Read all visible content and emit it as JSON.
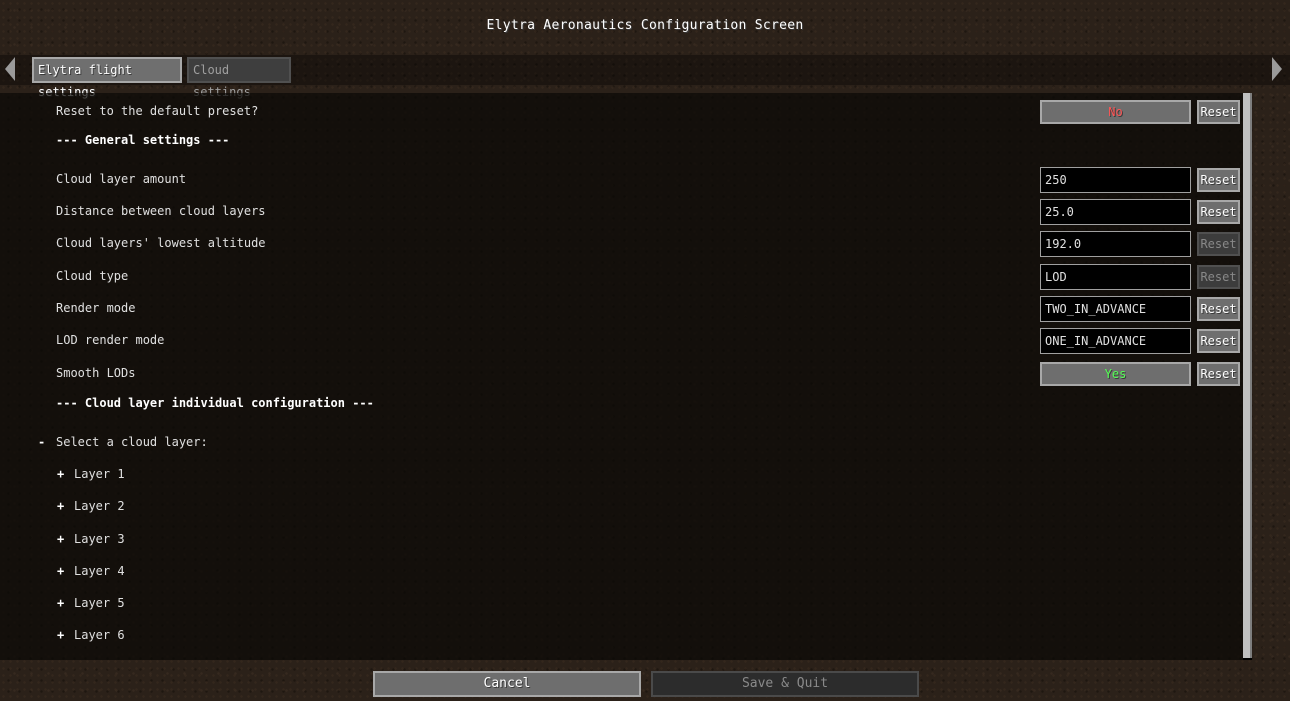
{
  "window": {
    "title": "Elytra Aeronautics Configuration Screen"
  },
  "tabs": [
    {
      "label": "Elytra flight settings",
      "active": true
    },
    {
      "label": "Cloud settings",
      "active": false
    }
  ],
  "settings": {
    "reset_preset": {
      "label": "Reset to the default preset?",
      "value": "No",
      "value_color": "#ff5555",
      "reset": "Reset"
    },
    "general_header": "--- General settings ---",
    "cloud_layer_amount": {
      "label": "Cloud layer amount",
      "value": "250",
      "reset": "Reset"
    },
    "distance_between": {
      "label": "Distance between cloud layers",
      "value": "25.0",
      "reset": "Reset"
    },
    "lowest_altitude": {
      "label": "Cloud layers' lowest altitude",
      "value": "192.0",
      "reset": "Reset"
    },
    "cloud_type": {
      "label": "Cloud type",
      "value": "LOD",
      "reset": "Reset"
    },
    "render_mode": {
      "label": "Render mode",
      "value": "TWO_IN_ADVANCE",
      "reset": "Reset"
    },
    "lod_render_mode": {
      "label": "LOD render mode",
      "value": "ONE_IN_ADVANCE",
      "reset": "Reset"
    },
    "smooth_lods": {
      "label": "Smooth LODs",
      "value": "Yes",
      "value_color": "#55ff55",
      "reset": "Reset"
    },
    "layer_header": "--- Cloud layer individual configuration ---",
    "select_layer": {
      "sign": "-",
      "label": "Select a cloud layer:"
    },
    "layers": [
      {
        "sign": "+",
        "label": "Layer 1"
      },
      {
        "sign": "+",
        "label": "Layer 2"
      },
      {
        "sign": "+",
        "label": "Layer 3"
      },
      {
        "sign": "+",
        "label": "Layer 4"
      },
      {
        "sign": "+",
        "label": "Layer 5"
      },
      {
        "sign": "+",
        "label": "Layer 6"
      }
    ]
  },
  "footer": {
    "cancel": "Cancel",
    "save_quit": "Save & Quit"
  }
}
